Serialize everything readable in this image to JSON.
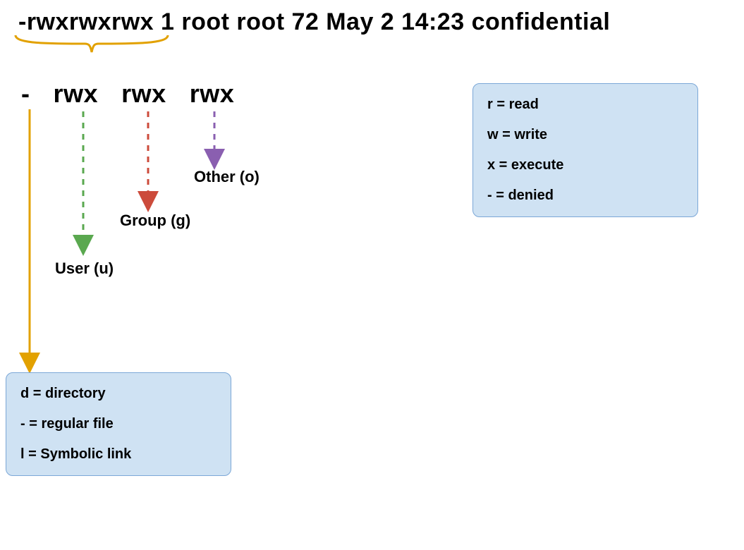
{
  "ls_output": "-rwxrwxrwx 1 root root  72 May  2 14:23 confidential",
  "permission_breakdown": {
    "type_char": "-",
    "user": "rwx",
    "group": "rwx",
    "other": "rwx"
  },
  "part_labels": {
    "user": "User (u)",
    "group": "Group (g)",
    "other": "Other (o)"
  },
  "permission_legend": {
    "r": "r = read",
    "w": "w = write",
    "x": "x = execute",
    "dash": "- = denied"
  },
  "type_legend": {
    "d": "d = directory",
    "dash": "- = regular file",
    "l": "l = Symbolic link"
  },
  "colors": {
    "brace": "#e2a100",
    "type_arrow": "#e2a100",
    "user_arrow": "#5aa84f",
    "group_arrow": "#cc4b3b",
    "other_arrow": "#8a5fb0",
    "legend_bg": "#cfe2f3",
    "legend_border": "#7ba7d7"
  }
}
